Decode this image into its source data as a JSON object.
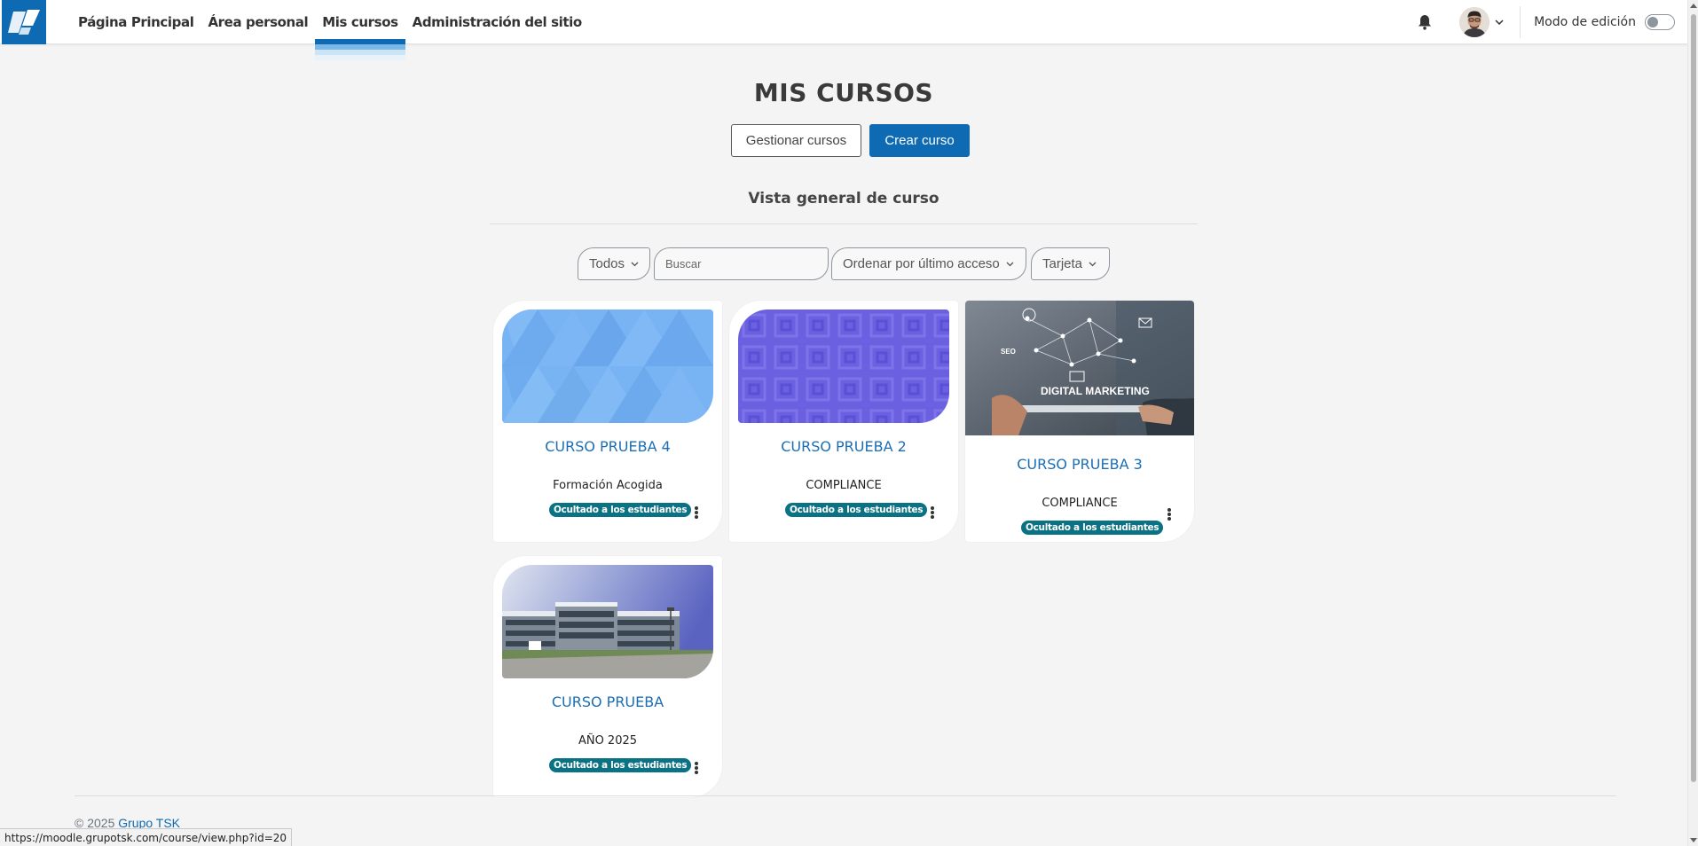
{
  "nav": {
    "items": [
      {
        "label": "Página Principal"
      },
      {
        "label": "Área personal"
      },
      {
        "label": "Mis cursos"
      },
      {
        "label": "Administración del sitio"
      }
    ],
    "edit_mode_label": "Modo de edición",
    "edit_mode_on": false
  },
  "page": {
    "title": "MIS CURSOS",
    "manage_button": "Gestionar cursos",
    "create_button": "Crear curso",
    "section_title": "Vista general de curso"
  },
  "filters": {
    "grouping": "Todos",
    "search_placeholder": "Buscar",
    "sort": "Ordenar por último acceso",
    "view": "Tarjeta"
  },
  "courses": [
    {
      "title": "CURSO PRUEBA 4",
      "category": "Formación Acogida",
      "badge": "Ocultado a los estudiantes",
      "image": "blue-triangles"
    },
    {
      "title": "CURSO PRUEBA 2",
      "category": "COMPLIANCE",
      "badge": "Ocultado a los estudiantes",
      "image": "purple-squares"
    },
    {
      "title": "CURSO PRUEBA 3",
      "category": "COMPLIANCE",
      "badge": "Ocultado a los estudiantes",
      "image": "digital-marketing-photo",
      "image_text": "DIGITAL MARKETING"
    },
    {
      "title": "CURSO PRUEBA",
      "category": "AÑO 2025",
      "badge": "Ocultado a los estudiantes",
      "image": "office-building-photo"
    }
  ],
  "footer": {
    "copyright": "© 2025",
    "link": "Grupo TSK"
  },
  "status_bar": {
    "url": "https://moodle.grupotsk.com/course/view.php?id=20"
  },
  "colors": {
    "brand": "#0f6ab4",
    "badge": "#0a7283",
    "course_title": "#1b6eb4"
  }
}
